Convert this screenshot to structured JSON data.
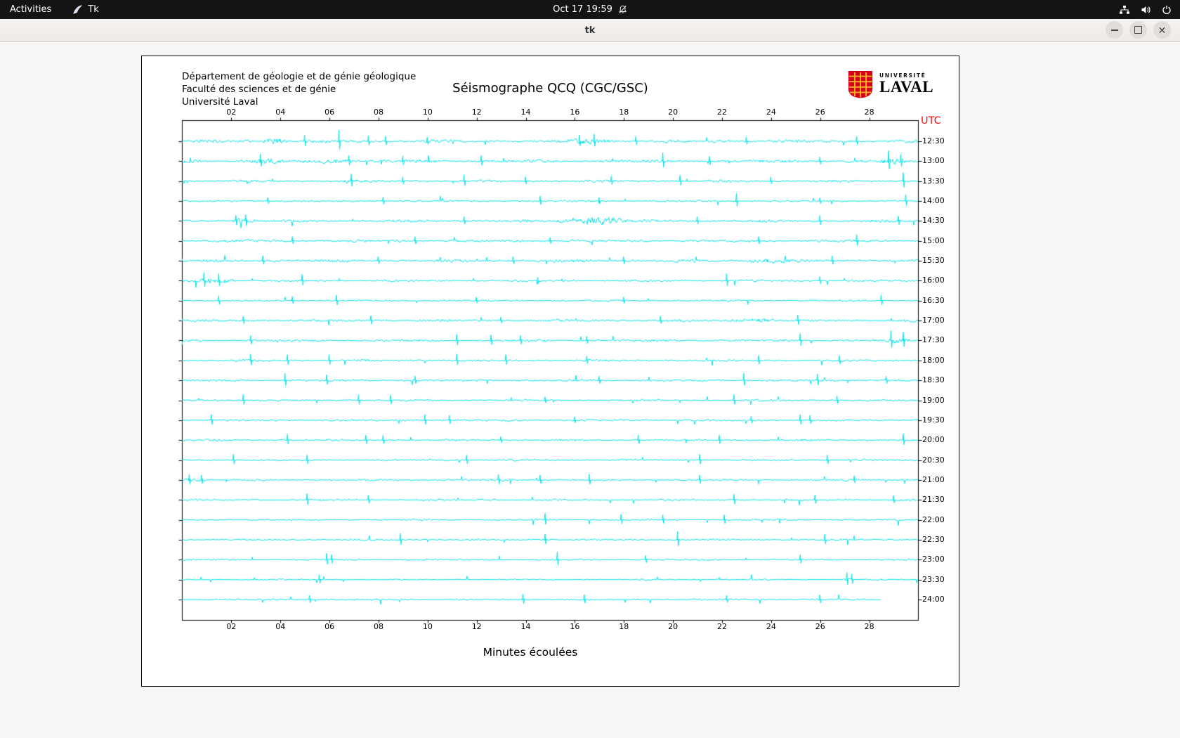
{
  "topbar": {
    "activities": "Activities",
    "app_name": "Tk",
    "clock": "Oct 17 19:59",
    "icons": [
      "tk-app-icon",
      "notifications-muted-icon",
      "network-tree-icon",
      "volume-icon",
      "power-icon"
    ]
  },
  "window": {
    "title": "tk",
    "controls": [
      "minimize",
      "maximize",
      "close"
    ]
  },
  "panel": {
    "institution": [
      "Département de géologie et de génie géologique",
      "Faculté des sciences et de génie",
      "Université Laval"
    ],
    "title": "Séismographe QCQ (CGC/GSC)",
    "logo": {
      "top": "UNIVERSITÉ",
      "bottom": "LAVAL"
    }
  },
  "chart_data": {
    "type": "line",
    "title": "Séismographe QCQ (CGC/GSC)",
    "xlabel": "Minutes écoulées",
    "utc_label": "UTC",
    "x_ticks": [
      "02",
      "04",
      "06",
      "08",
      "10",
      "12",
      "14",
      "16",
      "18",
      "20",
      "22",
      "24",
      "26",
      "28"
    ],
    "x_range_minutes": [
      0,
      30
    ],
    "trace_color": "#00E2E8",
    "axis_color": "#000000",
    "utc_color": "#EE1212",
    "rows": [
      {
        "label": "12:30",
        "amp": 2.6,
        "spikes": [
          [
            5.0,
            9
          ],
          [
            6.4,
            16
          ],
          [
            7.6,
            8
          ],
          [
            8.3,
            7
          ],
          [
            10.0,
            6
          ],
          [
            16.2,
            9
          ],
          [
            16.8,
            10
          ],
          [
            18.5,
            7
          ],
          [
            23.0,
            6
          ],
          [
            27.5,
            7
          ]
        ],
        "bursts": [
          [
            3.3,
            4.3,
            2.2
          ],
          [
            15.5,
            17.5,
            2.0
          ]
        ]
      },
      {
        "label": "13:00",
        "amp": 2.6,
        "spikes": [
          [
            3.2,
            10
          ],
          [
            6.8,
            8
          ],
          [
            9.0,
            7
          ],
          [
            12.2,
            8
          ],
          [
            19.6,
            12
          ],
          [
            21.5,
            7
          ],
          [
            26.0,
            6
          ],
          [
            28.8,
            15
          ],
          [
            29.3,
            10
          ]
        ],
        "bursts": [
          [
            2.8,
            4.2,
            2.0
          ],
          [
            5.5,
            7.0,
            1.8
          ],
          [
            28.4,
            29.6,
            2.5
          ]
        ]
      },
      {
        "label": "13:30",
        "amp": 2.0,
        "spikes": [
          [
            6.9,
            10
          ],
          [
            9.0,
            6
          ],
          [
            11.5,
            9
          ],
          [
            14.0,
            6
          ],
          [
            17.5,
            7
          ],
          [
            20.3,
            8
          ],
          [
            24.0,
            6
          ],
          [
            29.4,
            12
          ]
        ],
        "bursts": [
          [
            6.5,
            7.4,
            1.8
          ]
        ]
      },
      {
        "label": "14:00",
        "amp": 1.7,
        "spikes": [
          [
            3.5,
            5
          ],
          [
            8.2,
            6
          ],
          [
            14.6,
            7
          ],
          [
            17.0,
            5
          ],
          [
            22.6,
            11
          ],
          [
            26.0,
            5
          ],
          [
            29.5,
            9
          ]
        ],
        "bursts": []
      },
      {
        "label": "14:30",
        "amp": 2.2,
        "spikes": [
          [
            2.2,
            8
          ],
          [
            2.6,
            9
          ],
          [
            11.5,
            6
          ],
          [
            21.0,
            6
          ],
          [
            26.0,
            8
          ],
          [
            29.2,
            7
          ]
        ],
        "bursts": [
          [
            2.0,
            3.0,
            2.4
          ],
          [
            15.2,
            16.0,
            1.8
          ],
          [
            16.0,
            18.2,
            3.6
          ]
        ]
      },
      {
        "label": "15:00",
        "amp": 2.2,
        "spikes": [
          [
            4.5,
            6
          ],
          [
            9.5,
            6
          ],
          [
            15.0,
            5
          ],
          [
            23.5,
            6
          ],
          [
            27.5,
            9
          ]
        ],
        "bursts": []
      },
      {
        "label": "15:30",
        "amp": 2.4,
        "spikes": [
          [
            3.3,
            7
          ],
          [
            8.0,
            6
          ],
          [
            13.5,
            6
          ],
          [
            18.0,
            6
          ],
          [
            26.5,
            7
          ]
        ],
        "bursts": [
          [
            23.0,
            25.2,
            1.9
          ]
        ]
      },
      {
        "label": "16:00",
        "amp": 1.8,
        "spikes": [
          [
            0.9,
            12
          ],
          [
            1.5,
            10
          ],
          [
            4.9,
            9
          ],
          [
            14.5,
            5
          ],
          [
            22.2,
            10
          ],
          [
            26.0,
            6
          ]
        ],
        "bursts": [
          [
            0.4,
            2.2,
            3.0
          ]
        ]
      },
      {
        "label": "16:30",
        "amp": 1.5,
        "spikes": [
          [
            1.5,
            7
          ],
          [
            4.5,
            6
          ],
          [
            6.3,
            8
          ],
          [
            12.0,
            5
          ],
          [
            18.0,
            5
          ],
          [
            28.5,
            8
          ]
        ],
        "bursts": []
      },
      {
        "label": "17:00",
        "amp": 2.0,
        "spikes": [
          [
            2.5,
            6
          ],
          [
            7.7,
            7
          ],
          [
            13.0,
            5
          ],
          [
            19.5,
            6
          ],
          [
            25.1,
            8
          ]
        ],
        "bursts": [
          [
            22.3,
            24.2,
            2.1
          ]
        ]
      },
      {
        "label": "17:30",
        "amp": 2.0,
        "spikes": [
          [
            2.8,
            7
          ],
          [
            11.2,
            9
          ],
          [
            12.6,
            8
          ],
          [
            13.8,
            7
          ],
          [
            16.5,
            6
          ],
          [
            25.2,
            10
          ],
          [
            28.9,
            14
          ],
          [
            29.4,
            12
          ]
        ],
        "bursts": [
          [
            28.6,
            29.8,
            2.6
          ]
        ]
      },
      {
        "label": "18:00",
        "amp": 1.8,
        "spikes": [
          [
            2.8,
            9
          ],
          [
            4.3,
            8
          ],
          [
            6.0,
            8
          ],
          [
            11.2,
            9
          ],
          [
            13.2,
            8
          ],
          [
            16.5,
            6
          ],
          [
            23.5,
            7
          ],
          [
            26.8,
            7
          ]
        ],
        "bursts": []
      },
      {
        "label": "18:30",
        "amp": 1.8,
        "spikes": [
          [
            4.2,
            10
          ],
          [
            5.9,
            8
          ],
          [
            9.5,
            6
          ],
          [
            17.0,
            6
          ],
          [
            22.9,
            10
          ],
          [
            25.9,
            9
          ],
          [
            28.7,
            6
          ]
        ],
        "bursts": []
      },
      {
        "label": "19:00",
        "amp": 1.6,
        "spikes": [
          [
            2.5,
            8
          ],
          [
            7.2,
            8
          ],
          [
            8.5,
            7
          ],
          [
            14.8,
            5
          ],
          [
            22.5,
            8
          ],
          [
            26.7,
            6
          ]
        ],
        "bursts": []
      },
      {
        "label": "19:30",
        "amp": 1.7,
        "spikes": [
          [
            1.2,
            8
          ],
          [
            9.9,
            8
          ],
          [
            10.9,
            7
          ],
          [
            16.0,
            5
          ],
          [
            23.2,
            6
          ],
          [
            25.2,
            8
          ],
          [
            25.6,
            7
          ]
        ],
        "bursts": []
      },
      {
        "label": "20:00",
        "amp": 1.8,
        "spikes": [
          [
            4.3,
            8
          ],
          [
            7.5,
            7
          ],
          [
            8.2,
            7
          ],
          [
            13.0,
            5
          ],
          [
            18.6,
            7
          ],
          [
            21.9,
            7
          ],
          [
            29.4,
            9
          ]
        ],
        "bursts": []
      },
      {
        "label": "20:30",
        "amp": 1.6,
        "spikes": [
          [
            2.1,
            8
          ],
          [
            5.1,
            7
          ],
          [
            11.6,
            7
          ],
          [
            21.1,
            8
          ],
          [
            26.3,
            7
          ]
        ],
        "bursts": []
      },
      {
        "label": "21:00",
        "amp": 1.8,
        "spikes": [
          [
            0.3,
            8
          ],
          [
            0.8,
            7
          ],
          [
            12.9,
            8
          ],
          [
            14.6,
            7
          ],
          [
            16.6,
            8
          ],
          [
            21.1,
            7
          ],
          [
            27.4,
            6
          ]
        ],
        "bursts": [
          [
            0.0,
            1.0,
            2.0
          ]
        ]
      },
      {
        "label": "21:30",
        "amp": 1.6,
        "spikes": [
          [
            5.1,
            9
          ],
          [
            7.6,
            7
          ],
          [
            22.5,
            8
          ],
          [
            25.8,
            7
          ],
          [
            29.0,
            6
          ]
        ],
        "bursts": []
      },
      {
        "label": "22:00",
        "amp": 1.4,
        "spikes": [
          [
            14.8,
            9
          ],
          [
            17.9,
            8
          ],
          [
            19.6,
            7
          ],
          [
            22.1,
            7
          ]
        ],
        "bursts": []
      },
      {
        "label": "22:30",
        "amp": 1.5,
        "spikes": [
          [
            8.9,
            9
          ],
          [
            14.8,
            8
          ],
          [
            20.2,
            12
          ],
          [
            26.2,
            8
          ]
        ],
        "bursts": []
      },
      {
        "label": "23:00",
        "amp": 1.3,
        "spikes": [
          [
            5.9,
            9
          ],
          [
            6.1,
            7
          ],
          [
            15.3,
            11
          ],
          [
            18.9,
            6
          ],
          [
            25.2,
            7
          ]
        ],
        "bursts": []
      },
      {
        "label": "23:30",
        "amp": 1.2,
        "spikes": [
          [
            5.6,
            7
          ],
          [
            27.1,
            10
          ],
          [
            27.3,
            8
          ]
        ],
        "bursts": [
          [
            26.8,
            27.5,
            2.0
          ]
        ]
      },
      {
        "label": "24:00",
        "amp": 1.2,
        "len": 28.5,
        "spikes": [
          [
            5.2,
            6
          ],
          [
            13.9,
            8
          ],
          [
            16.4,
            7
          ],
          [
            22.2,
            6
          ],
          [
            26.0,
            7
          ]
        ],
        "bursts": []
      }
    ]
  }
}
